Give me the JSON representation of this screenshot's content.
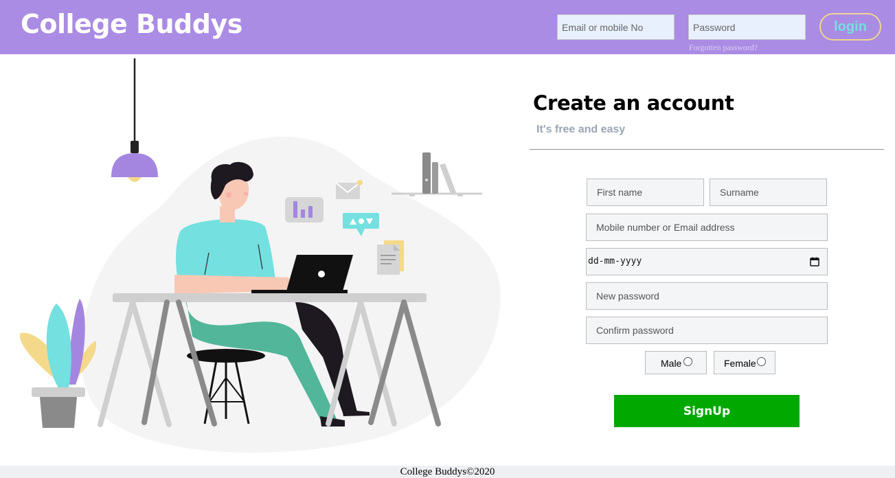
{
  "header": {
    "brand": "College Buddys",
    "email_placeholder": "Email or mobile No",
    "password_placeholder": "Password",
    "forgot_label": "Forgotten password?",
    "login_label": "login"
  },
  "signup": {
    "title": "Create an account",
    "subtitle": "It's free and easy",
    "first_name_placeholder": "First name",
    "surname_placeholder": "Surname",
    "contact_placeholder": "Mobile number or Email address",
    "dob_placeholder": "dd-mm-yyyy",
    "new_password_placeholder": "New password",
    "confirm_password_placeholder": "Confirm password",
    "gender_male": "Male",
    "gender_female": "Female",
    "submit_label": "SignUp"
  },
  "footer": {
    "text": "College Buddys©2020"
  },
  "colors": {
    "header_bg": "#aa8ce4",
    "signup_button": "#00a800",
    "login_text": "#74e0e0",
    "login_border": "#f0d590",
    "field_bg": "#f4f5f7"
  },
  "icons": {
    "calendar": "calendar-icon",
    "illustration": "student-at-laptop-illustration"
  }
}
